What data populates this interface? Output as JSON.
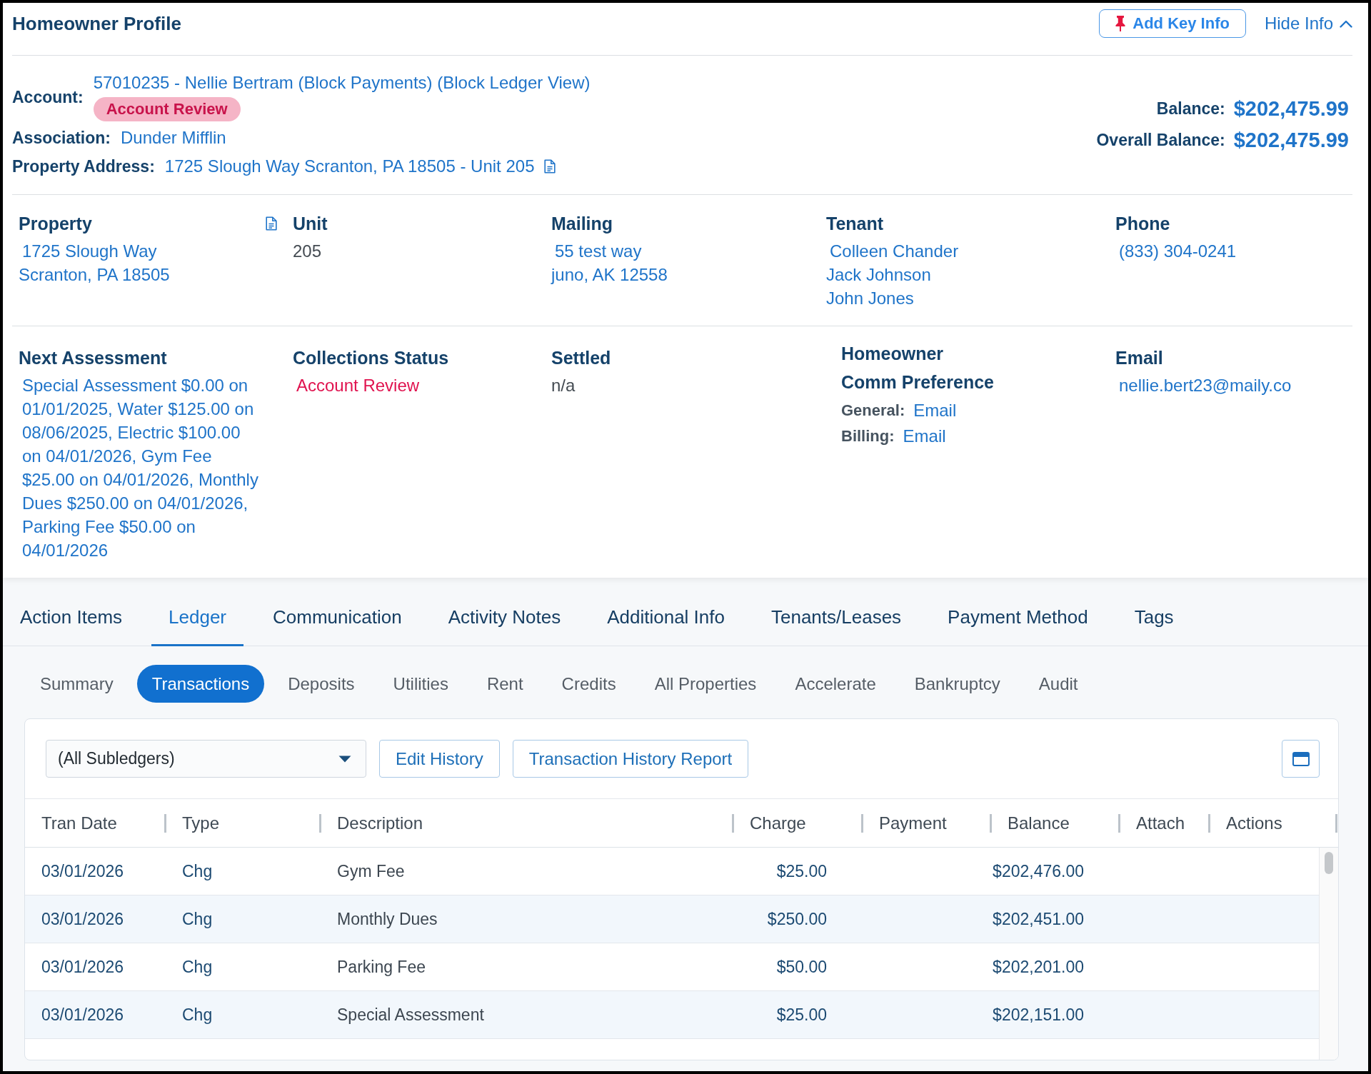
{
  "header": {
    "title": "Homeowner Profile",
    "add_key_info": "Add Key Info",
    "hide_info": "Hide Info"
  },
  "account": {
    "label": "Account:",
    "value": "57010235 - Nellie Bertram (Block Payments) (Block Ledger View)",
    "badge": "Account Review"
  },
  "association": {
    "label": "Association:",
    "value": "Dunder Mifflin"
  },
  "property_address": {
    "label": "Property Address:",
    "value": "1725 Slough Way Scranton, PA 18505 - Unit 205"
  },
  "balances": [
    {
      "label": "Balance:",
      "value": "$202,475.99"
    },
    {
      "label": "Overall Balance:",
      "value": "$202,475.99"
    }
  ],
  "detail_sections": [
    {
      "fields": [
        {
          "kind": "address",
          "heading": "Property",
          "lines": [
            "1725 Slough Way",
            "Scranton, PA 18505"
          ]
        },
        {
          "kind": "text",
          "heading": "Unit",
          "lines": [
            "205"
          ]
        },
        {
          "kind": "links",
          "heading": "Mailing",
          "lines": [
            "55 test way",
            "juno, AK 12558"
          ]
        },
        {
          "kind": "links",
          "heading": "Tenant",
          "lines": [
            "Colleen Chander",
            "Jack Johnson",
            "John Jones"
          ]
        },
        {
          "kind": "links",
          "heading": "Phone",
          "lines": [
            "(833) 304-0241"
          ]
        }
      ]
    },
    {
      "fields": [
        {
          "kind": "paragraph",
          "heading": "Next Assessment",
          "text": "Special Assessment $0.00 on 01/01/2025, Water $125.00 on 08/06/2025, Electric $100.00 on 04/01/2026, Gym Fee $25.00 on 04/01/2026, Monthly Dues $250.00 on 04/01/2026, Parking Fee $50.00 on 04/01/2026"
        },
        {
          "kind": "status",
          "heading": "Collections Status",
          "lines": [
            "Account Review"
          ]
        },
        {
          "kind": "text",
          "heading": "Settled",
          "lines": [
            "n/a"
          ]
        },
        {
          "kind": "preferences",
          "heading": "Homeowner Comm Preference",
          "preferences": [
            {
              "label": "General:",
              "value": "Email"
            },
            {
              "label": "Billing:",
              "value": "Email"
            }
          ]
        },
        {
          "kind": "links",
          "heading": "Email",
          "lines": [
            "nellie.bert23@maily.co"
          ]
        }
      ]
    }
  ],
  "tabs": [
    {
      "label": "Action Items",
      "selected": false
    },
    {
      "label": "Ledger",
      "selected": true
    },
    {
      "label": "Communication",
      "selected": false
    },
    {
      "label": "Activity Notes",
      "selected": false
    },
    {
      "label": "Additional Info",
      "selected": false
    },
    {
      "label": "Tenants/Leases",
      "selected": false
    },
    {
      "label": "Payment Method",
      "selected": false
    },
    {
      "label": "Tags",
      "selected": false
    }
  ],
  "subtabs": [
    {
      "label": "Summary",
      "selected": false
    },
    {
      "label": "Transactions",
      "selected": true
    },
    {
      "label": "Deposits",
      "selected": false
    },
    {
      "label": "Utilities",
      "selected": false
    },
    {
      "label": "Rent",
      "selected": false
    },
    {
      "label": "Credits",
      "selected": false
    },
    {
      "label": "All Properties",
      "selected": false
    },
    {
      "label": "Accelerate",
      "selected": false
    },
    {
      "label": "Bankruptcy",
      "selected": false
    },
    {
      "label": "Audit",
      "selected": false
    }
  ],
  "toolbar": {
    "subledger": "(All Subledgers)",
    "buttons": [
      "Edit History",
      "Transaction History Report"
    ]
  },
  "table": {
    "columns": [
      "Tran Date",
      "Type",
      "Description",
      "Charge",
      "Payment",
      "Balance",
      "Attach",
      "Actions"
    ],
    "rows": [
      {
        "tran_date": "03/01/2026",
        "type": "Chg",
        "description": "Gym Fee",
        "charge": "$25.00",
        "balance": "$202,476.00"
      },
      {
        "tran_date": "03/01/2026",
        "type": "Chg",
        "description": "Monthly Dues",
        "charge": "$250.00",
        "balance": "$202,451.00"
      },
      {
        "tran_date": "03/01/2026",
        "type": "Chg",
        "description": "Parking Fee",
        "charge": "$50.00",
        "balance": "$202,201.00"
      },
      {
        "tran_date": "03/01/2026",
        "type": "Chg",
        "description": "Special Assessment",
        "charge": "$25.00",
        "balance": "$202,151.00"
      }
    ]
  }
}
